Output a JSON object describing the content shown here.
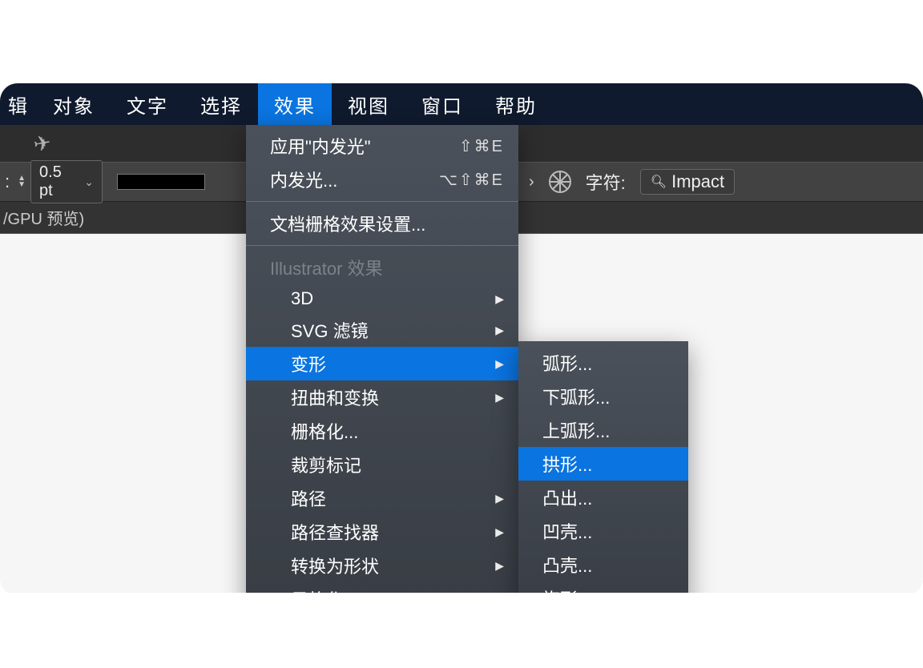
{
  "menubar": {
    "items": [
      {
        "label": "对象"
      },
      {
        "label": "文字"
      },
      {
        "label": "选择"
      },
      {
        "label": "效果",
        "active": true
      },
      {
        "label": "视图"
      },
      {
        "label": "窗口"
      },
      {
        "label": "帮助"
      }
    ],
    "edge_fragment": "辑"
  },
  "controlbar": {
    "stroke_value": "0.5 pt",
    "font_label": "字符:",
    "font_value": "Impact"
  },
  "tabbar": {
    "tab_label": "/GPU 预览)"
  },
  "effects_menu": {
    "apply_last": {
      "label": "应用\"内发光\"",
      "shortcut": "⇧⌘E"
    },
    "last_settings": {
      "label": "内发光...",
      "shortcut": "⌥⇧⌘E"
    },
    "doc_raster": {
      "label": "文档栅格效果设置..."
    },
    "section_header": "Illustrator 效果",
    "items": [
      {
        "label": "3D",
        "arrow": true
      },
      {
        "label": "SVG 滤镜",
        "arrow": true
      },
      {
        "label": "变形",
        "arrow": true,
        "active": true
      },
      {
        "label": "扭曲和变换",
        "arrow": true
      },
      {
        "label": "栅格化..."
      },
      {
        "label": "裁剪标记"
      },
      {
        "label": "路径",
        "arrow": true
      },
      {
        "label": "路径查找器",
        "arrow": true
      },
      {
        "label": "转换为形状",
        "arrow": true
      },
      {
        "label": "风格化",
        "arrow": true
      }
    ]
  },
  "warp_submenu": {
    "items": [
      {
        "label": "弧形..."
      },
      {
        "label": "下弧形..."
      },
      {
        "label": "上弧形..."
      },
      {
        "label": "拱形...",
        "active": true
      },
      {
        "label": "凸出..."
      },
      {
        "label": "凹壳..."
      },
      {
        "label": "凸壳..."
      },
      {
        "label": "旗形..."
      }
    ]
  }
}
